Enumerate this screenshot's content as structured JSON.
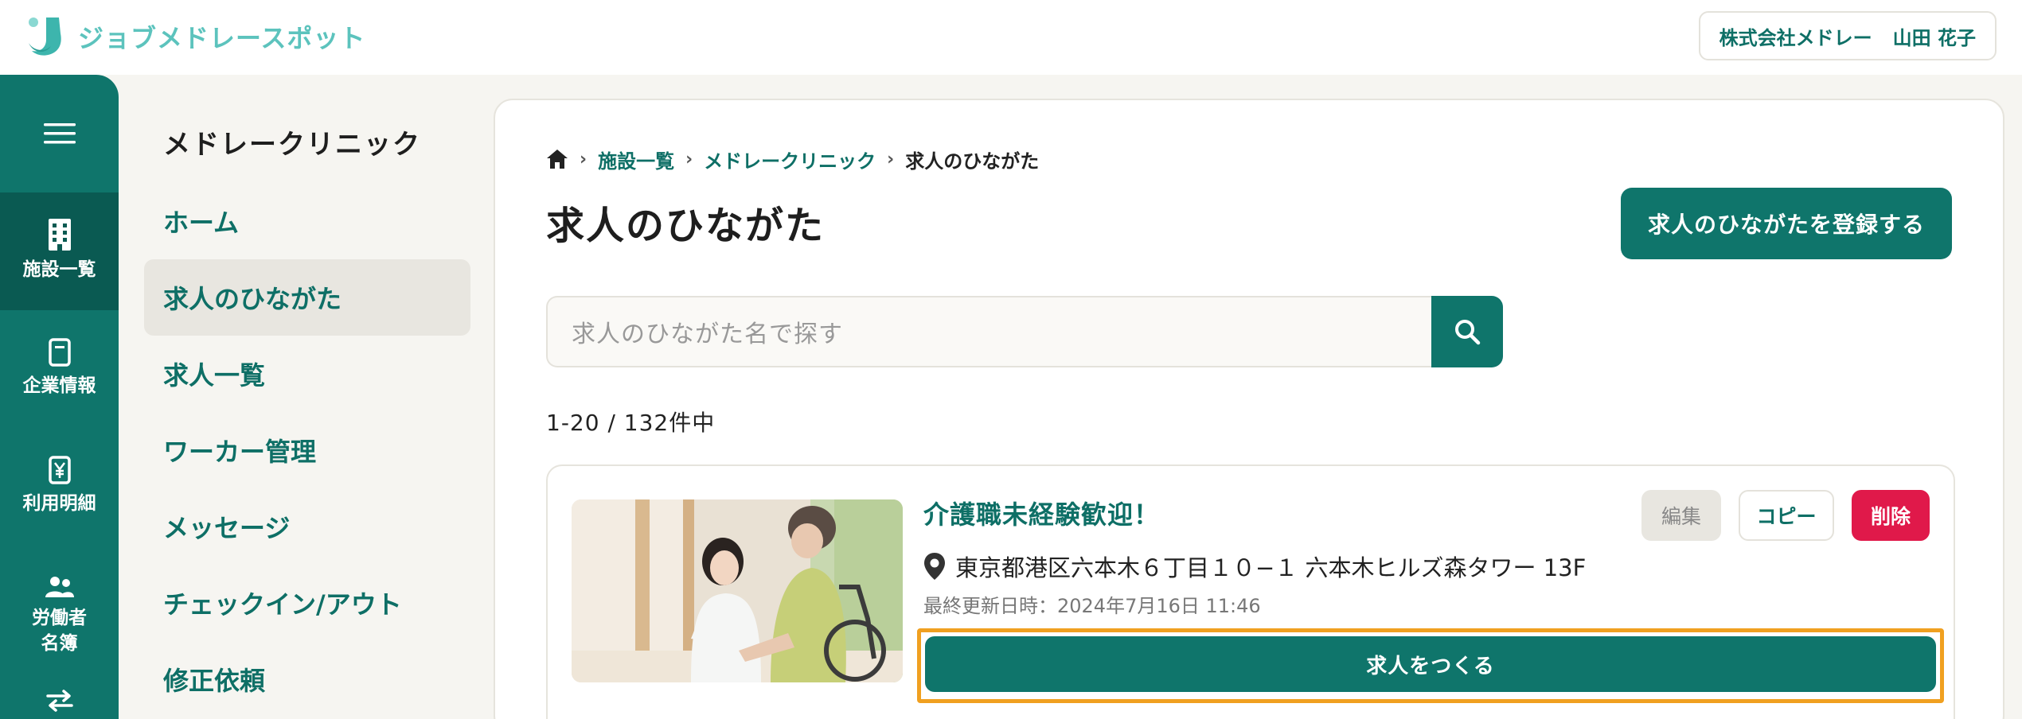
{
  "brand": {
    "logo_text": "ジョブメドレースポット",
    "accent": "#5cc3bd",
    "primary": "#0f756b",
    "danger": "#e0194a",
    "highlight": "#f0a020"
  },
  "header": {
    "company": "株式会社メドレー",
    "user_name": "山田 花子"
  },
  "rail": {
    "menu_icon": "hamburger-icon",
    "items": [
      {
        "label": "施設一覧",
        "icon": "building-icon",
        "active": true
      },
      {
        "label": "企業情報",
        "icon": "document-icon",
        "active": false
      },
      {
        "label": "利用明細",
        "icon": "yen-receipt-icon",
        "active": false
      },
      {
        "label": "労働者\n名簿",
        "label_line1": "労働者",
        "label_line2": "名簿",
        "icon": "people-icon",
        "active": false
      },
      {
        "label": "",
        "icon": "swap-arrows-icon",
        "active": false
      }
    ]
  },
  "subnav": {
    "title": "メドレークリニック",
    "items": [
      {
        "label": "ホーム",
        "active": false
      },
      {
        "label": "求人のひながた",
        "active": true
      },
      {
        "label": "求人一覧",
        "active": false
      },
      {
        "label": "ワーカー管理",
        "active": false
      },
      {
        "label": "メッセージ",
        "active": false
      },
      {
        "label": "チェックイン/アウト",
        "active": false
      },
      {
        "label": "修正依頼",
        "active": false
      }
    ]
  },
  "main": {
    "breadcrumb": {
      "home_icon": "home-icon",
      "items": [
        "施設一覧",
        "メドレークリニック"
      ],
      "current": "求人のひながた"
    },
    "title": "求人のひながた",
    "register_button": "求人のひながたを登録する",
    "search": {
      "placeholder": "求人のひながた名で探す",
      "icon": "search-icon"
    },
    "result_count": "1-20 / 132件中",
    "templates": [
      {
        "title": "介護職未経験歓迎！",
        "address": "東京都港区六本木６丁目１０−１ 六本木ヒルズ森タワー 13F",
        "updated": "最終更新日時：2024年7月16日 11:46",
        "edit_label": "編集",
        "copy_label": "コピー",
        "delete_label": "削除",
        "create_label": "求人をつくる"
      }
    ]
  }
}
